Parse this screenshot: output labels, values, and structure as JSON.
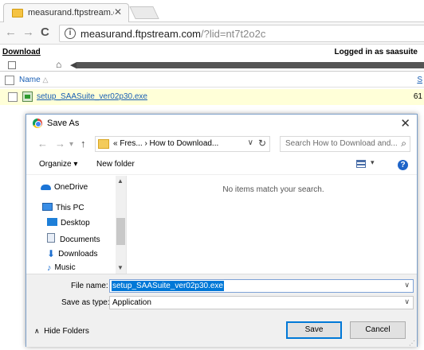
{
  "browser": {
    "tab_title": "measurand.ftpstream.com",
    "url_host": "measurand.ftpstream.com",
    "url_rest": "/?lid=nt7t2o2c"
  },
  "page": {
    "download_label": "Download",
    "logged_in": "Logged in as saasuite",
    "name_header": "Name",
    "size_header": "S",
    "file_name": "setup_SAASuite_ver02p30.exe",
    "file_size": "61"
  },
  "dialog": {
    "title": "Save As",
    "breadcrumb": "«  Fres...  ›  How to Download...",
    "search_placeholder": "Search How to Download and...",
    "organize": "Organize ▾",
    "new_folder": "New folder",
    "nav": {
      "onedrive": "OneDrive",
      "this_pc": "This PC",
      "desktop": "Desktop",
      "documents": "Documents",
      "downloads": "Downloads",
      "music": "Music"
    },
    "empty_message": "No items match your search.",
    "file_name_label": "File name:",
    "file_name_value": "setup_SAASuite_ver02p30.exe",
    "save_type_label": "Save as type:",
    "save_type_value": "Application",
    "hide_folders": "Hide Folders",
    "save_button": "Save",
    "cancel_button": "Cancel"
  },
  "icons": [
    "folder-tab-icon",
    "tab-close-icon",
    "back-icon",
    "forward-icon",
    "reload-icon",
    "info-icon",
    "home-icon",
    "chrome-icon",
    "close-icon",
    "up-arrow-icon",
    "refresh-icon",
    "search-icon",
    "view-icon",
    "help-icon",
    "onedrive-icon",
    "pc-icon",
    "desktop-icon",
    "documents-icon",
    "downloads-icon",
    "music-icon",
    "chevron-up-icon"
  ],
  "colors": {
    "link": "#1a5fb4",
    "selection": "#0078d7",
    "row_highlight": "#ffffd8",
    "dialog_border": "#7a9ec8"
  }
}
